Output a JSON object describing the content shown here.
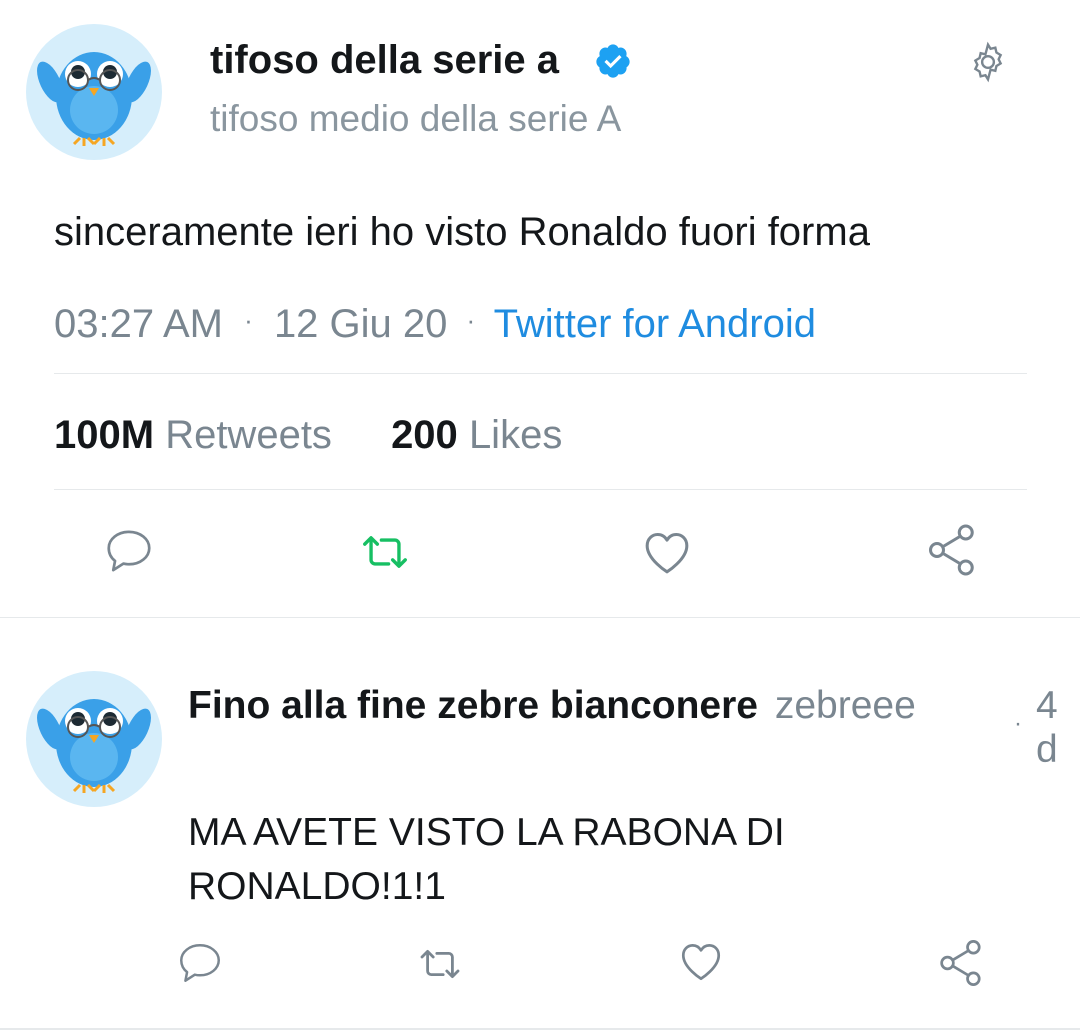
{
  "colors": {
    "text": "#14171a",
    "muted": "#7a8690",
    "link": "#1f8ce0",
    "verified": "#1da1f2",
    "retweet_active": "#17bf63",
    "icon": "#7a8690",
    "divider": "#e6e9eb",
    "avatar_bg": "#d6eefb"
  },
  "tweet": {
    "author": {
      "display_name": "tifoso della serie a",
      "handle": "tifoso medio della serie A",
      "verified": true,
      "avatar_icon": "owl-avatar-icon"
    },
    "text": "sinceramente ieri ho visto Ronaldo fuori forma",
    "time": "03:27 AM",
    "sep1": "·",
    "date": "12 Giu 20",
    "sep2": "·",
    "source": "Twitter for Android",
    "stats": {
      "retweets_count": "100M",
      "retweets_label": "Retweets",
      "likes_count": "200",
      "likes_label": "Likes"
    },
    "actions": [
      "reply-icon",
      "retweet-icon",
      "like-icon",
      "share-icon"
    ],
    "settings_icon": "gear-icon"
  },
  "reply": {
    "author": {
      "display_name": "Fino alla fine zebre bianconere",
      "handle": "zebreee",
      "avatar_icon": "owl-avatar-icon"
    },
    "sep": "·",
    "age_line1": "4",
    "age_line2": "d",
    "text_line1": "MA AVETE VISTO LA RABONA DI",
    "text_line2": "RONALDO!1!1",
    "actions": [
      "reply-icon",
      "retweet-icon",
      "like-icon",
      "share-icon"
    ]
  }
}
